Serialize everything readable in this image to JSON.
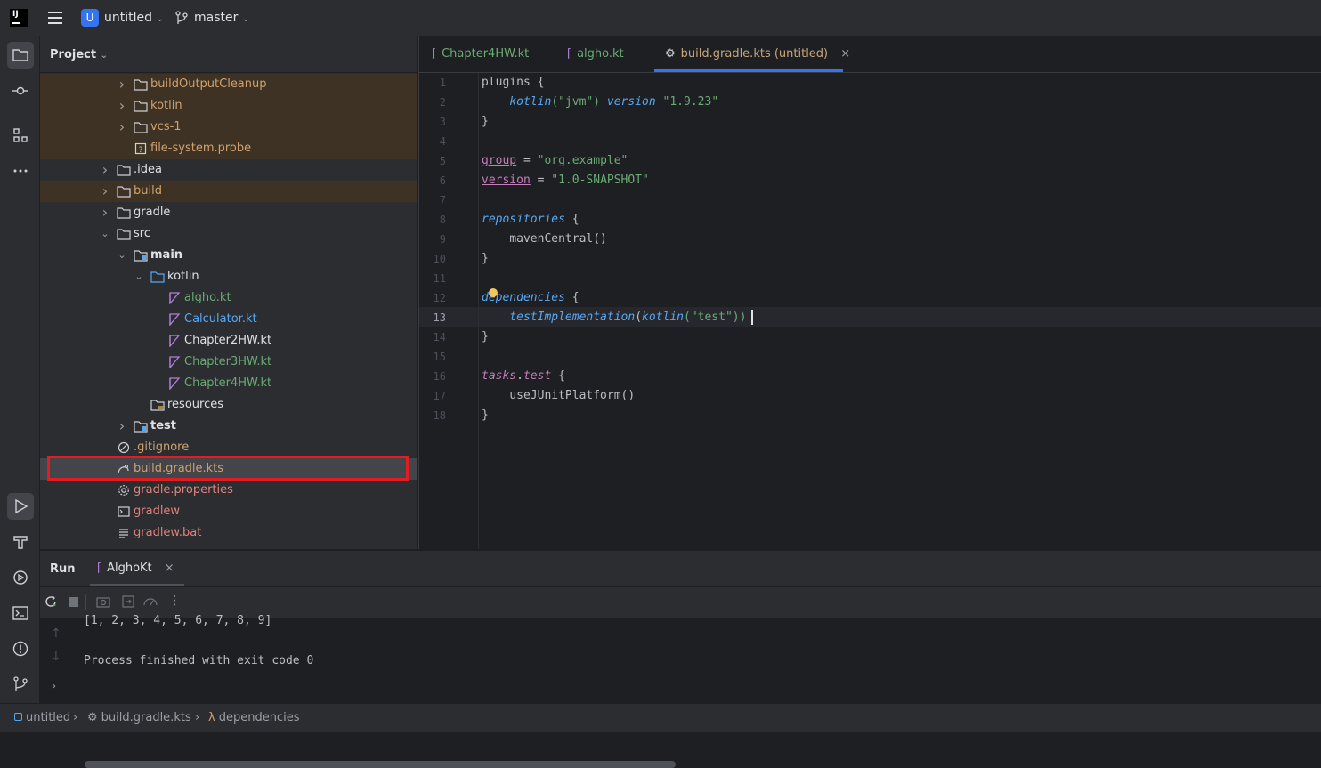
{
  "titlebar": {
    "app_logo": "IJ",
    "project_initial": "U",
    "project_name": "untitled",
    "branch": "master"
  },
  "strip": {
    "top_icons": [
      "folder-icon",
      "commit-icon",
      "structure-icon",
      "more-icon"
    ],
    "bottom_icons": [
      "run-icon",
      "build-icon",
      "services-icon",
      "terminal-icon",
      "problems-icon",
      "git-icon"
    ]
  },
  "project": {
    "title": "Project",
    "tree": [
      {
        "label": "buildOutputCleanup",
        "arrow": ">",
        "icon": "folder-icon"
      },
      {
        "label": "kotlin",
        "arrow": ">",
        "icon": "folder-icon"
      },
      {
        "label": "vcs-1",
        "arrow": ">",
        "icon": "folder-icon"
      },
      {
        "label": "file-system.probe",
        "arrow": "",
        "icon": "unknown-file-icon"
      },
      {
        "label": ".idea",
        "arrow": ">",
        "icon": "folder-icon"
      },
      {
        "label": "build",
        "arrow": ">",
        "icon": "folder-icon"
      },
      {
        "label": "gradle",
        "arrow": ">",
        "icon": "folder-icon"
      },
      {
        "label": "src",
        "arrow": "v",
        "icon": "folder-icon"
      },
      {
        "label": "main",
        "arrow": "v",
        "icon": "module-folder-icon"
      },
      {
        "label": "kotlin",
        "arrow": "v",
        "icon": "source-folder-icon"
      },
      {
        "label": "algho.kt",
        "arrow": "",
        "icon": "kotlin-file-icon"
      },
      {
        "label": "Calculator.kt",
        "arrow": "",
        "icon": "kotlin-file-icon"
      },
      {
        "label": "Chapter2HW.kt",
        "arrow": "",
        "icon": "kotlin-file-icon"
      },
      {
        "label": "Chapter3HW.kt",
        "arrow": "",
        "icon": "kotlin-file-icon"
      },
      {
        "label": "Chapter4HW.kt",
        "arrow": "",
        "icon": "kotlin-file-icon"
      },
      {
        "label": "resources",
        "arrow": "",
        "icon": "resources-folder-icon"
      },
      {
        "label": "test",
        "arrow": ">",
        "icon": "module-folder-icon"
      },
      {
        "label": ".gitignore",
        "arrow": "",
        "icon": "ignore-file-icon"
      },
      {
        "label": "build.gradle.kts",
        "arrow": "",
        "icon": "gradle-kts-icon"
      },
      {
        "label": "gradle.properties",
        "arrow": "",
        "icon": "gear-icon"
      },
      {
        "label": "gradlew",
        "arrow": "",
        "icon": "terminal-file-icon"
      },
      {
        "label": "gradlew.bat",
        "arrow": "",
        "icon": "text-file-icon"
      }
    ]
  },
  "editor": {
    "tabs": [
      {
        "label": "Chapter4HW.kt"
      },
      {
        "label": "algho.kt"
      },
      {
        "label": "build.gradle.kts (untitled)",
        "close": "×"
      }
    ],
    "line_numbers": [
      "1",
      "2",
      "3",
      "4",
      "5",
      "6",
      "7",
      "8",
      "9",
      "10",
      "11",
      "12",
      "13",
      "14",
      "15",
      "16",
      "17",
      "18"
    ],
    "code": {
      "l1": "plugins {",
      "l2a": "kotlin",
      "l2b": "(\"jvm\") ",
      "l2c": "version",
      "l2d": " \"1.9.23\"",
      "l3": "}",
      "l5a": "group",
      "l5b": " = ",
      "l5c": "\"org.example\"",
      "l6a": "version",
      "l6b": " = ",
      "l6c": "\"1.0-SNAPSHOT\"",
      "l8a": "repositories",
      "l8b": " {",
      "l9": "mavenCentral()",
      "l10": "}",
      "l12a": "dependencies",
      "l12b": " {",
      "l13a": "testImplementation",
      "l13b": "(",
      "l13c": "kotlin",
      "l13d": "(\"test\"))",
      "l14": "}",
      "l16a": "tasks",
      "l16b": ".",
      "l16c": "test",
      "l16d": " {",
      "l17": "useJUnitPlatform()",
      "l18": "}"
    }
  },
  "run": {
    "title": "Run",
    "tab_label": "AlghoKt",
    "tab_close": "×",
    "output_line1": "[1, 2, 3, 4, 5, 6, 7, 8, 9]",
    "output_line2": "Process finished with exit code 0"
  },
  "status": {
    "crumb1": "untitled",
    "crumb2": "build.gradle.kts",
    "crumb3": "dependencies"
  }
}
